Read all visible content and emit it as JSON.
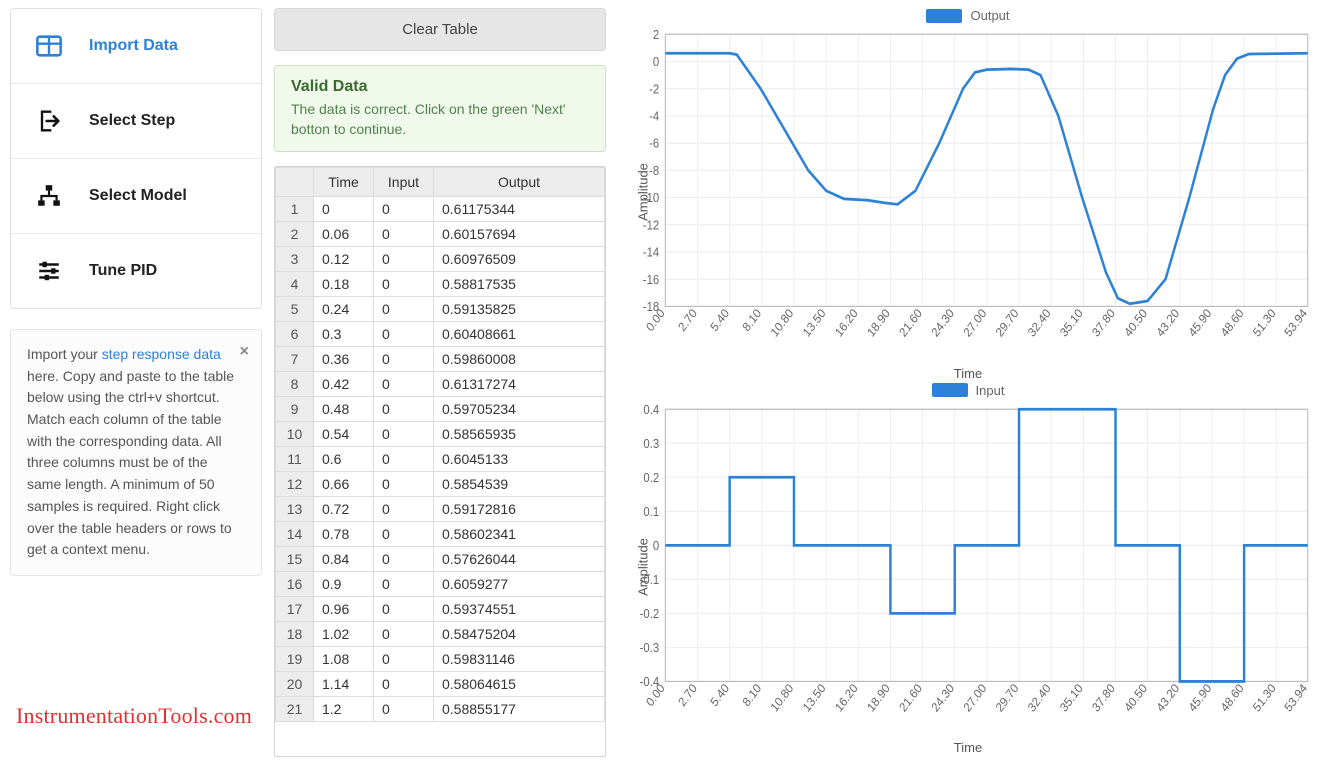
{
  "nav": {
    "items": [
      {
        "label": "Import Data",
        "active": true,
        "icon": "table-icon"
      },
      {
        "label": "Select Step",
        "active": false,
        "icon": "share-icon"
      },
      {
        "label": "Select Model",
        "active": false,
        "icon": "hierarchy-icon"
      },
      {
        "label": "Tune PID",
        "active": false,
        "icon": "sliders-icon"
      }
    ]
  },
  "help": {
    "prefix": "Import your ",
    "link": "step response data",
    "body": " here. Copy and paste to the table below using the ctrl+v shortcut. Match each column of the table with the corresponding data. All three columns must be of the same length. A minimum of 50 samples is required. Right click over the table headers or rows to get a context menu."
  },
  "clear_label": "Clear Table",
  "valid": {
    "title": "Valid Data",
    "text": "The data is correct. Click on the green 'Next' botton to continue."
  },
  "table": {
    "headers": [
      "",
      "Time",
      "Input",
      "Output"
    ],
    "rows": [
      [
        1,
        "0",
        "0",
        "0.61175344"
      ],
      [
        2,
        "0.06",
        "0",
        "0.60157694"
      ],
      [
        3,
        "0.12",
        "0",
        "0.60976509"
      ],
      [
        4,
        "0.18",
        "0",
        "0.58817535"
      ],
      [
        5,
        "0.24",
        "0",
        "0.59135825"
      ],
      [
        6,
        "0.3",
        "0",
        "0.60408661"
      ],
      [
        7,
        "0.36",
        "0",
        "0.59860008"
      ],
      [
        8,
        "0.42",
        "0",
        "0.61317274"
      ],
      [
        9,
        "0.48",
        "0",
        "0.59705234"
      ],
      [
        10,
        "0.54",
        "0",
        "0.58565935"
      ],
      [
        11,
        "0.6",
        "0",
        "0.6045133"
      ],
      [
        12,
        "0.66",
        "0",
        "0.5854539"
      ],
      [
        13,
        "0.72",
        "0",
        "0.59172816"
      ],
      [
        14,
        "0.78",
        "0",
        "0.58602341"
      ],
      [
        15,
        "0.84",
        "0",
        "0.57626044"
      ],
      [
        16,
        "0.9",
        "0",
        "0.6059277"
      ],
      [
        17,
        "0.96",
        "0",
        "0.59374551"
      ],
      [
        18,
        "1.02",
        "0",
        "0.58475204"
      ],
      [
        19,
        "1.08",
        "0",
        "0.59831146"
      ],
      [
        20,
        "1.14",
        "0",
        "0.58064615"
      ],
      [
        21,
        "1.2",
        "0",
        "0.58855177"
      ]
    ]
  },
  "watermark": "InstrumentationTools.com",
  "chart_data": [
    {
      "type": "line",
      "title": "Output",
      "xlabel": "Time",
      "ylabel": "Amplitude",
      "xlim": [
        0,
        53.94
      ],
      "ylim": [
        -18,
        2
      ],
      "x_ticks": [
        "0.00",
        "2.70",
        "5.40",
        "8.10",
        "10.80",
        "13.50",
        "16.20",
        "18.90",
        "21.60",
        "24.30",
        "27.00",
        "29.70",
        "32.40",
        "35.10",
        "37.80",
        "40.50",
        "43.20",
        "45.90",
        "48.60",
        "51.30",
        "53.94"
      ],
      "y_ticks": [
        2,
        0,
        -2,
        -4,
        -6,
        -8,
        -10,
        -12,
        -14,
        -16,
        -18
      ],
      "series": [
        {
          "name": "Output",
          "points": [
            [
              0,
              0.6
            ],
            [
              5.4,
              0.6
            ],
            [
              6.0,
              0.5
            ],
            [
              8.0,
              -2.0
            ],
            [
              10.0,
              -5.0
            ],
            [
              12.0,
              -8.0
            ],
            [
              13.5,
              -9.5
            ],
            [
              15.0,
              -10.1
            ],
            [
              17.0,
              -10.2
            ],
            [
              18.5,
              -10.4
            ],
            [
              19.5,
              -10.5
            ],
            [
              21.0,
              -9.5
            ],
            [
              23.0,
              -6.0
            ],
            [
              25.0,
              -2.0
            ],
            [
              26.0,
              -0.8
            ],
            [
              27.0,
              -0.6
            ],
            [
              29.0,
              -0.55
            ],
            [
              30.5,
              -0.6
            ],
            [
              31.5,
              -1.0
            ],
            [
              33.0,
              -4.0
            ],
            [
              35.0,
              -10.0
            ],
            [
              37.0,
              -15.5
            ],
            [
              38.0,
              -17.4
            ],
            [
              39.0,
              -17.8
            ],
            [
              40.5,
              -17.6
            ],
            [
              42.0,
              -16.0
            ],
            [
              44.0,
              -10.0
            ],
            [
              46.0,
              -3.5
            ],
            [
              47.0,
              -1.0
            ],
            [
              48.0,
              0.2
            ],
            [
              49.0,
              0.55
            ],
            [
              53.94,
              0.6
            ]
          ]
        }
      ]
    },
    {
      "type": "line",
      "title": "Input",
      "xlabel": "Time",
      "ylabel": "Amplitude",
      "xlim": [
        0,
        53.94
      ],
      "ylim": [
        -0.4,
        0.4
      ],
      "x_ticks": [
        "0.00",
        "2.70",
        "5.40",
        "8.10",
        "10.80",
        "13.50",
        "16.20",
        "18.90",
        "21.60",
        "24.30",
        "27.00",
        "29.70",
        "32.40",
        "35.10",
        "37.80",
        "40.50",
        "43.20",
        "45.90",
        "48.60",
        "51.30",
        "53.94"
      ],
      "y_ticks": [
        0.4,
        0.3,
        0.2,
        0.1,
        0,
        -0.1,
        -0.2,
        -0.3,
        -0.4
      ],
      "series": [
        {
          "name": "Input",
          "points": [
            [
              0,
              0
            ],
            [
              5.4,
              0
            ],
            [
              5.4,
              0.2
            ],
            [
              10.8,
              0.2
            ],
            [
              10.8,
              0
            ],
            [
              18.9,
              0
            ],
            [
              18.9,
              -0.2
            ],
            [
              24.3,
              -0.2
            ],
            [
              24.3,
              0
            ],
            [
              29.7,
              0
            ],
            [
              29.7,
              0.4
            ],
            [
              37.8,
              0.4
            ],
            [
              37.8,
              0
            ],
            [
              43.2,
              0
            ],
            [
              43.2,
              -0.4
            ],
            [
              48.6,
              -0.4
            ],
            [
              48.6,
              0
            ],
            [
              53.94,
              0
            ]
          ]
        }
      ]
    }
  ]
}
